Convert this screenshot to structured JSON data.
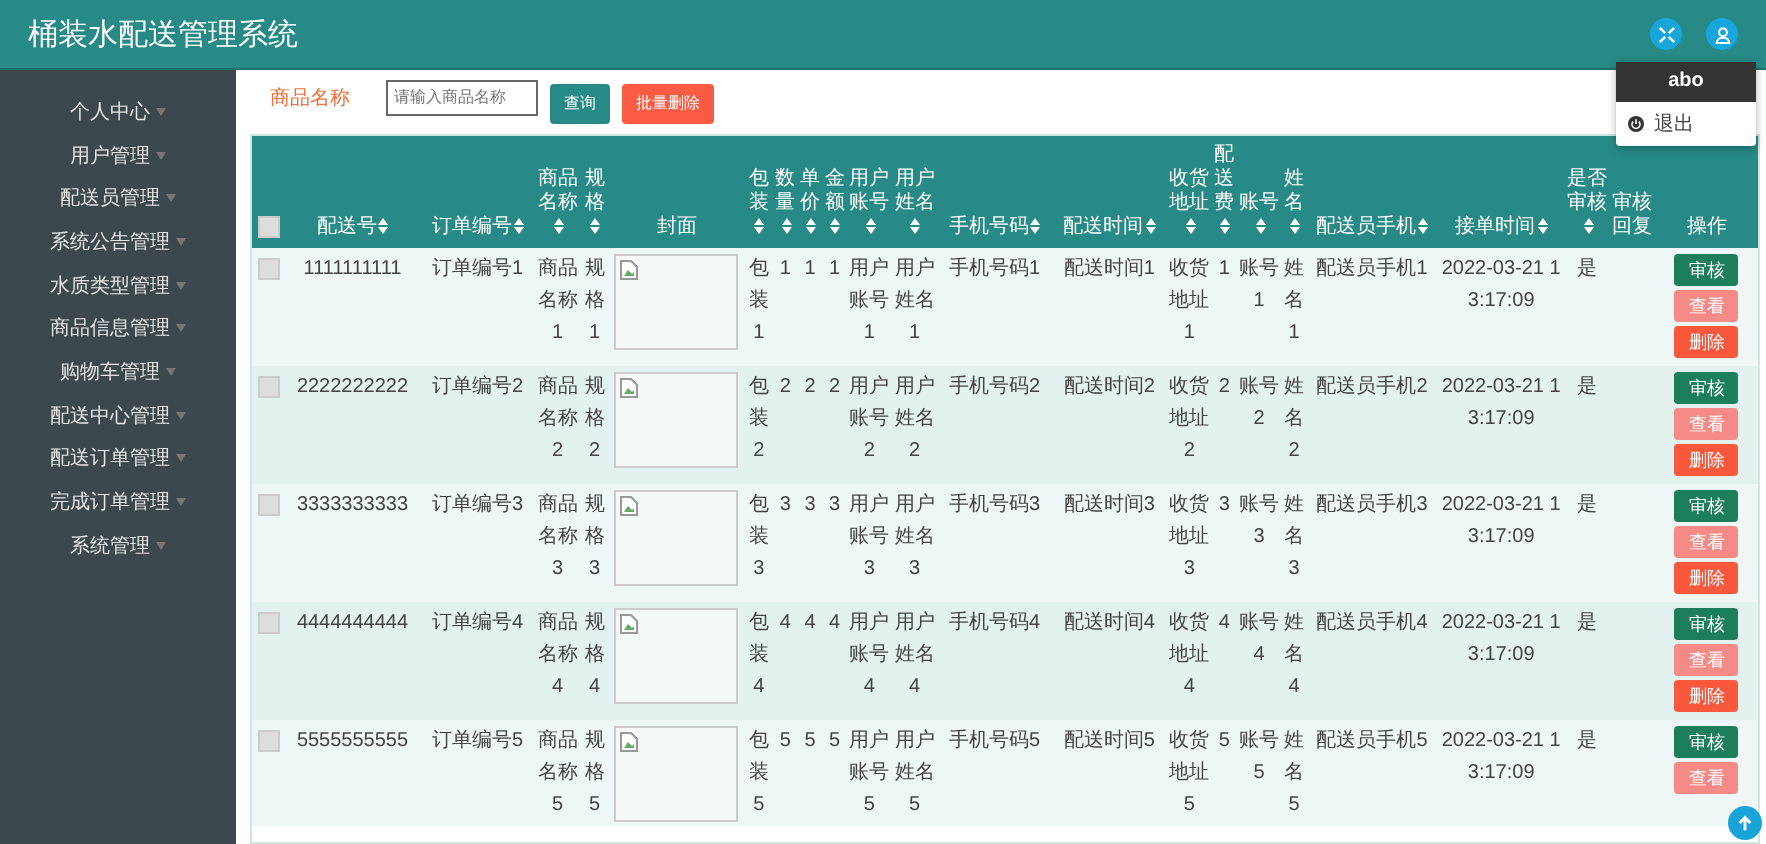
{
  "header": {
    "title": "桶装水配送管理系统"
  },
  "user_menu": {
    "username": "abo",
    "items": [
      {
        "label": "退出"
      }
    ]
  },
  "sidebar": {
    "items": [
      {
        "label": "个人中心"
      },
      {
        "label": "用户管理"
      },
      {
        "label": "配送员管理"
      },
      {
        "label": "系统公告管理"
      },
      {
        "label": "水质类型管理"
      },
      {
        "label": "商品信息管理"
      },
      {
        "label": "购物车管理"
      },
      {
        "label": "配送中心管理"
      },
      {
        "label": "配送订单管理"
      },
      {
        "label": "完成订单管理"
      },
      {
        "label": "系统管理"
      }
    ]
  },
  "search": {
    "label": "商品名称",
    "placeholder": "请输入商品名称",
    "buttons": [
      {
        "label": "查询",
        "kind": "primary"
      },
      {
        "label": "批量删除",
        "kind": "danger"
      }
    ]
  },
  "table": {
    "all_checked": false,
    "columns": [
      {
        "label": "配送号",
        "kind": "text",
        "sortable": true
      },
      {
        "label": "订单编号",
        "kind": "text",
        "sortable": true
      },
      {
        "label": "商品名称",
        "kind": "text",
        "sortable": true
      },
      {
        "label": "规格",
        "kind": "text",
        "sortable": true
      },
      {
        "label": "封面",
        "kind": "image",
        "sortable": false
      },
      {
        "label": "包装",
        "kind": "text",
        "sortable": true
      },
      {
        "label": "数量",
        "kind": "text",
        "sortable": true
      },
      {
        "label": "单价",
        "kind": "text",
        "sortable": true
      },
      {
        "label": "金额",
        "kind": "text",
        "sortable": true
      },
      {
        "label": "用户账号",
        "kind": "text",
        "sortable": true
      },
      {
        "label": "用户姓名",
        "kind": "text",
        "sortable": true
      },
      {
        "label": "手机号码",
        "kind": "text",
        "sortable": true
      },
      {
        "label": "配送时间",
        "kind": "text",
        "sortable": true
      },
      {
        "label": "收货地址",
        "kind": "text",
        "sortable": true
      },
      {
        "label": "配送费",
        "kind": "text",
        "sortable": true
      },
      {
        "label": "账号",
        "kind": "text",
        "sortable": true
      },
      {
        "label": "姓名",
        "kind": "text",
        "sortable": true
      },
      {
        "label": "配送员手机",
        "kind": "text",
        "sortable": true
      },
      {
        "label": "接单时间",
        "kind": "text",
        "sortable": true
      },
      {
        "label": "是否审核",
        "kind": "text",
        "sortable": true
      },
      {
        "label": "审核回复",
        "kind": "empty",
        "sortable": false
      },
      {
        "label": "操作",
        "kind": "actions",
        "sortable": false
      }
    ],
    "rows": [
      {
        "checked": false,
        "cells": [
          "1111111111",
          "订单编号1",
          "商品名称1",
          "规格1",
          "",
          "包装1",
          "1",
          "1",
          "1",
          "用户账号1",
          "用户姓名1",
          "手机号码1",
          "配送时间1",
          "收货地址1",
          "1",
          "账号1",
          "姓名1",
          "配送员手机1",
          "2022-03-21 13:17:09",
          "是"
        ],
        "actions": [
          {
            "label": "审核",
            "kind": "audit"
          },
          {
            "label": "查看",
            "kind": "view"
          },
          {
            "label": "删除",
            "kind": "delete"
          }
        ]
      },
      {
        "checked": false,
        "cells": [
          "2222222222",
          "订单编号2",
          "商品名称2",
          "规格2",
          "",
          "包装2",
          "2",
          "2",
          "2",
          "用户账号2",
          "用户姓名2",
          "手机号码2",
          "配送时间2",
          "收货地址2",
          "2",
          "账号2",
          "姓名2",
          "配送员手机2",
          "2022-03-21 13:17:09",
          "是"
        ],
        "actions": [
          {
            "label": "审核",
            "kind": "audit"
          },
          {
            "label": "查看",
            "kind": "view"
          },
          {
            "label": "删除",
            "kind": "delete"
          }
        ]
      },
      {
        "checked": false,
        "cells": [
          "3333333333",
          "订单编号3",
          "商品名称3",
          "规格3",
          "",
          "包装3",
          "3",
          "3",
          "3",
          "用户账号3",
          "用户姓名3",
          "手机号码3",
          "配送时间3",
          "收货地址3",
          "3",
          "账号3",
          "姓名3",
          "配送员手机3",
          "2022-03-21 13:17:09",
          "是"
        ],
        "actions": [
          {
            "label": "审核",
            "kind": "audit"
          },
          {
            "label": "查看",
            "kind": "view"
          },
          {
            "label": "删除",
            "kind": "delete"
          }
        ]
      },
      {
        "checked": false,
        "cells": [
          "4444444444",
          "订单编号4",
          "商品名称4",
          "规格4",
          "",
          "包装4",
          "4",
          "4",
          "4",
          "用户账号4",
          "用户姓名4",
          "手机号码4",
          "配送时间4",
          "收货地址4",
          "4",
          "账号4",
          "姓名4",
          "配送员手机4",
          "2022-03-21 13:17:09",
          "是"
        ],
        "actions": [
          {
            "label": "审核",
            "kind": "audit"
          },
          {
            "label": "查看",
            "kind": "view"
          },
          {
            "label": "删除",
            "kind": "delete"
          }
        ]
      },
      {
        "checked": false,
        "cells": [
          "5555555555",
          "订单编号5",
          "商品名称5",
          "规格5",
          "",
          "包装5",
          "5",
          "5",
          "5",
          "用户账号5",
          "用户姓名5",
          "手机号码5",
          "配送时间5",
          "收货地址5",
          "5",
          "账号5",
          "姓名5",
          "配送员手机5",
          "2022-03-21 13:17:09",
          "是"
        ],
        "actions": [
          {
            "label": "审核",
            "kind": "audit"
          },
          {
            "label": "查看",
            "kind": "view"
          }
        ]
      }
    ]
  }
}
